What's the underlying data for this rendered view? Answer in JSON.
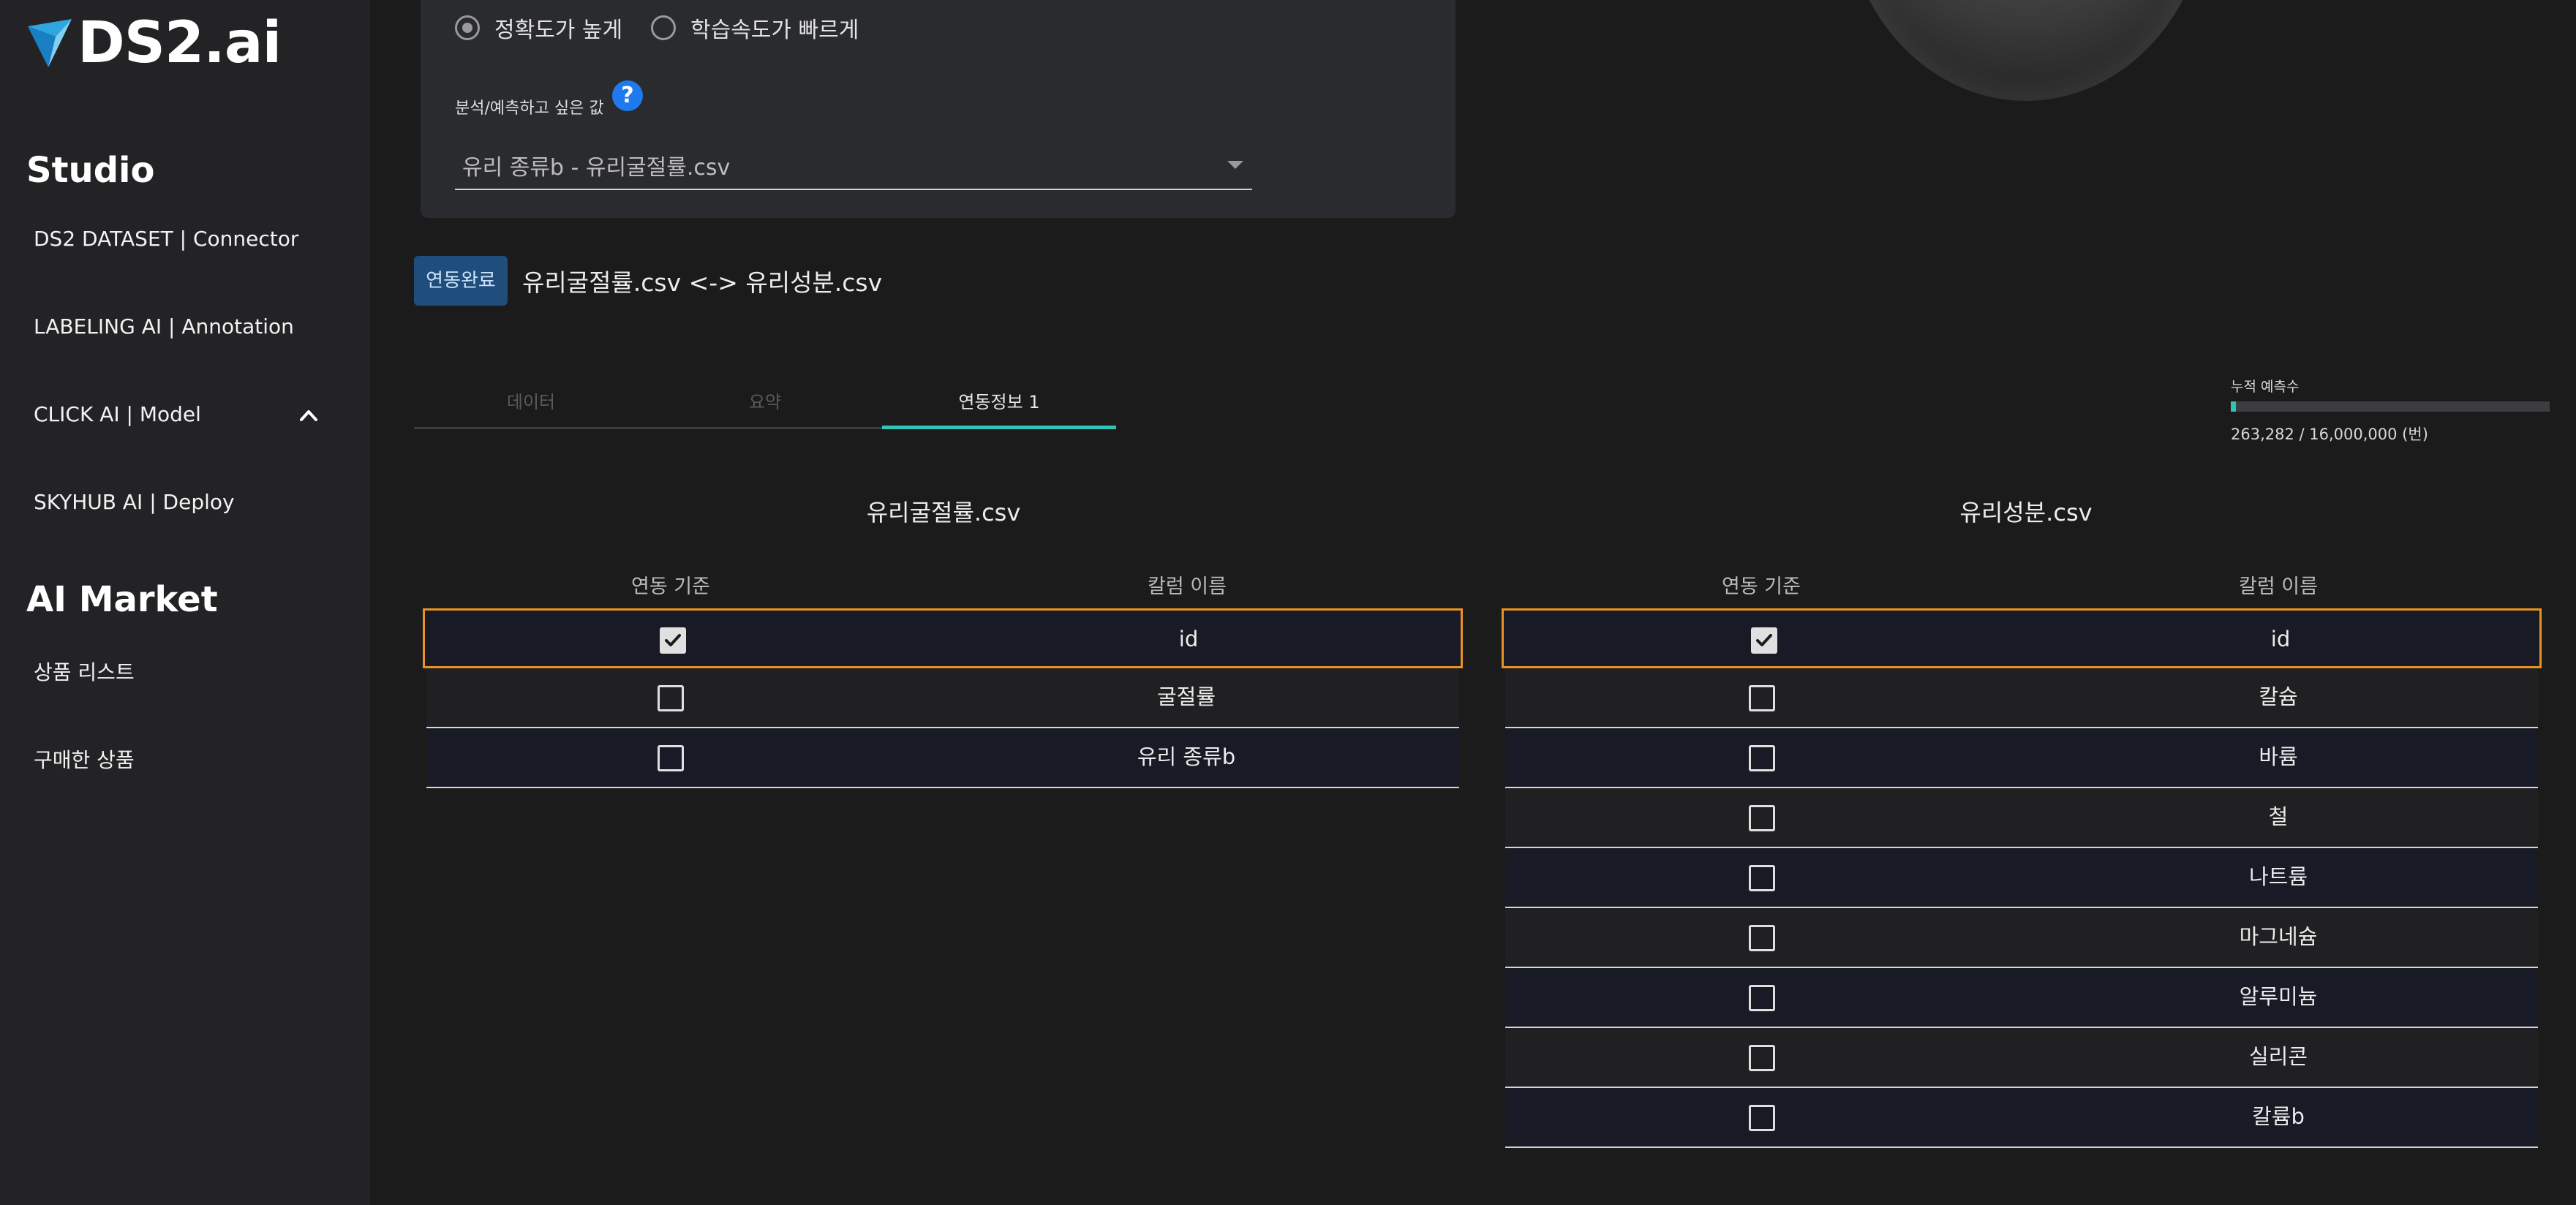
{
  "brand": {
    "logo_text": "DS2.ai"
  },
  "sidebar": {
    "studio_title": "Studio",
    "items": [
      {
        "label": "DS2 DATASET | Connector"
      },
      {
        "label": "LABELING AI | Annotation"
      },
      {
        "label": "CLICK AI | Model"
      },
      {
        "label": "SKYHUB AI | Deploy"
      }
    ],
    "market_title": "AI Market",
    "market_items": [
      {
        "label": "상품 리스트"
      },
      {
        "label": "구매한 상품"
      }
    ]
  },
  "options": {
    "radio_accuracy": "정확도가 높게",
    "radio_speed": "학습속도가 빠르게",
    "target_label": "분석/예측하고 싶은 값",
    "target_value": "유리 종류b - 유리굴절률.csv"
  },
  "link": {
    "badge": "연동완료",
    "text": "유리굴절률.csv <-> 유리성분.csv"
  },
  "tabs": [
    {
      "label": "데이터"
    },
    {
      "label": "요약"
    },
    {
      "label": "연동정보 1"
    }
  ],
  "usage": {
    "label": "누적 예측수",
    "count_text": "263,282 / 16,000,000 (번)",
    "fraction": 0.0165,
    "accent": "#2ec4b6"
  },
  "left_table": {
    "title": "유리굴절률.csv",
    "col_key": "연동 기준",
    "col_name": "칼럼 이름",
    "rows": [
      {
        "name": "id",
        "checked": true
      },
      {
        "name": "굴절률",
        "checked": false
      },
      {
        "name": "유리 종류b",
        "checked": false
      }
    ]
  },
  "right_table": {
    "title": "유리성분.csv",
    "col_key": "연동 기준",
    "col_name": "칼럼 이름",
    "rows": [
      {
        "name": "id",
        "checked": true
      },
      {
        "name": "칼슘",
        "checked": false
      },
      {
        "name": "바륨",
        "checked": false
      },
      {
        "name": "철",
        "checked": false
      },
      {
        "name": "나트륨",
        "checked": false
      },
      {
        "name": "마그네슘",
        "checked": false
      },
      {
        "name": "알루미늄",
        "checked": false
      },
      {
        "name": "실리콘",
        "checked": false
      },
      {
        "name": "칼륨b",
        "checked": false
      }
    ]
  },
  "colors": {
    "selected_border": "#e89225",
    "badge_bg": "#1f4e7d",
    "help": "#1f7af0"
  }
}
